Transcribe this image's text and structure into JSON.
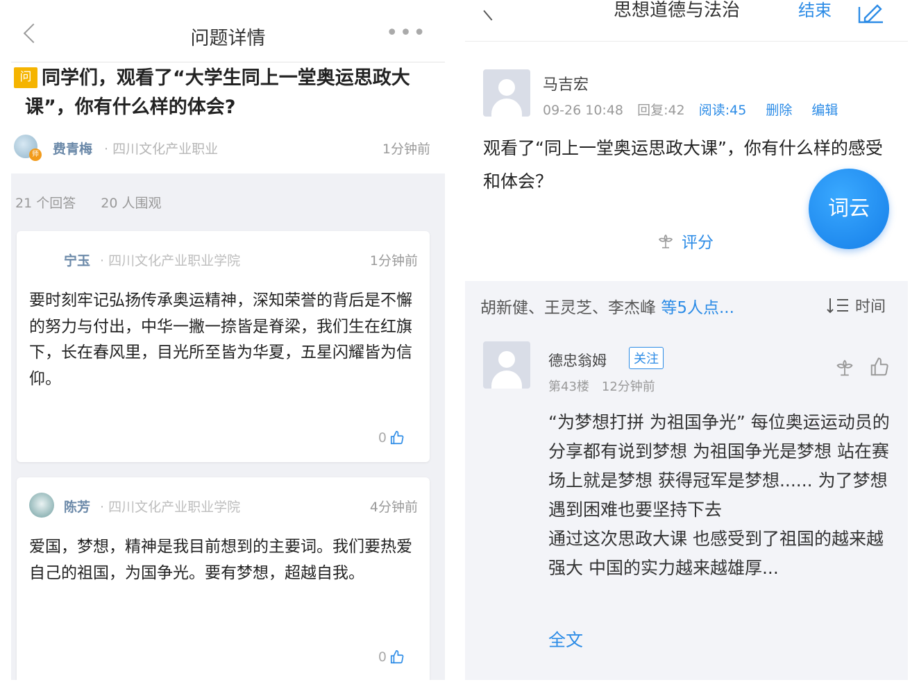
{
  "left": {
    "nav": {
      "title": "问题详情",
      "more": "•••"
    },
    "question": {
      "badge": "问",
      "title": "同学们，观看了“大学生同上一堂奥运思政大课”，你有什么样的体会?"
    },
    "asker": {
      "avatar_tag": "师",
      "name": "费青梅",
      "org": "· 四川文化产业职业",
      "time": "1分钟前"
    },
    "stats": {
      "answers": "21 个回答",
      "viewers": "20 人围观"
    },
    "answers": [
      {
        "name": "宁玉",
        "org": "· 四川文化产业职业学院",
        "time": "1分钟前",
        "body": "要时刻牢记弘扬传承奥运精神，深知荣誉的背后是不懈的努力与付出，中华一撇一捺皆是脊梁，我们生在红旗下，长在春风里，目光所至皆为华夏，五星闪耀皆为信仰。",
        "likes": "0"
      },
      {
        "name": "陈芳",
        "org": "· 四川文化产业职业学院",
        "time": "4分钟前",
        "body": "爱国，梦想，精神是我目前想到的主要词。我们要热爱自己的祖国，为国争光。要有梦想，超越自我。",
        "likes": "0"
      }
    ]
  },
  "right": {
    "nav": {
      "title": "思想道德与法治",
      "end": "结束"
    },
    "author": {
      "name": "马吉宏",
      "date": "09-26 10:48",
      "replies": "回复:42",
      "reads": "阅读:45",
      "delete": "删除",
      "edit": "编辑"
    },
    "question": "观看了“同上一堂奥运思政大课”，你有什么样的感受和体会？",
    "wordcloud": "词云",
    "rate": "评分",
    "likers": {
      "names": "胡新健、王灵芝、李杰峰 ",
      "more": "等5人点..."
    },
    "sort": "时间",
    "reply": {
      "name": "德忠翁姆",
      "follow": "关注",
      "floor": "第43楼",
      "time": "12分钟前",
      "body": "“为梦想打拼 为祖国争光” 每位奥运运动员的分享都有说到梦想 为祖国争光是梦想 站在赛场上就是梦想 获得冠军是梦想...... 为了梦想 遇到困难也要坚持下去\n通过这次思政大课 也感受到了祖国的越来越强大 中国的实力越来越雄厚...",
      "fulltext": "全文"
    }
  },
  "colors": {
    "accent": "#2b8be6",
    "badge": "#f5b400",
    "band": "#f0f1f5"
  },
  "icons": [
    "back-arrow-icon",
    "more-icon",
    "thumb-up-icon",
    "flower-icon",
    "edit-icon",
    "sort-icon"
  ]
}
